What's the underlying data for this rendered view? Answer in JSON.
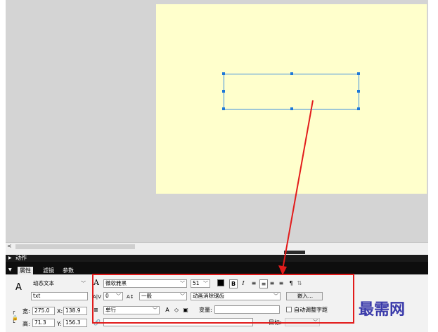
{
  "panels": {
    "actions_label": "动作",
    "tabs": [
      {
        "label": "属性",
        "active": true
      },
      {
        "label": "滤镜",
        "active": false
      },
      {
        "label": "参数",
        "active": false
      }
    ]
  },
  "scroll": {
    "left_arrow": "<"
  },
  "props": {
    "text_tool_icon": "A",
    "text_type": "动态文本",
    "instance_name": "txt",
    "font_name": "微软雅黑",
    "font_size": "51",
    "spacing": "0",
    "baseline": "一般",
    "antialias": "动画消除锯齿",
    "embed_button": "嵌入...",
    "line_type": "单行",
    "var_label": "变量:",
    "var_value": "",
    "autokern_label": "自动调整字距",
    "target_label": "目标:",
    "url_value": "",
    "width_label": "宽:",
    "width_value": "275.0",
    "x_label": "X:",
    "x_value": "138.9",
    "height_label": "高:",
    "height_value": "71.3",
    "y_label": "Y:",
    "y_value": "156.3",
    "bold_label": "B",
    "italic_label": "I",
    "para_label": "¶"
  },
  "watermark": "最需网",
  "colors": {
    "highlight": "#e21b1b",
    "stage": "#ffffcc",
    "selection": "#3b8de0"
  }
}
